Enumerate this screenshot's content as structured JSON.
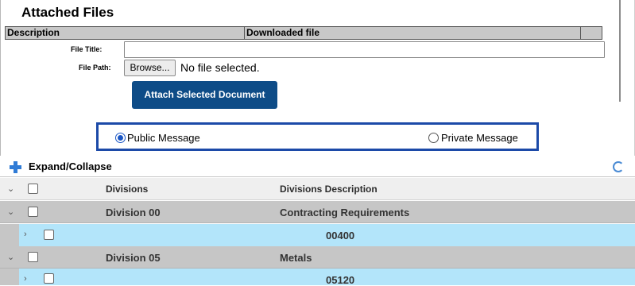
{
  "attached_files": {
    "title": "Attached Files",
    "columns": [
      "Description",
      "Downloaded file"
    ],
    "file_title_label": "File Title:",
    "file_title_value": "",
    "file_path_label": "File Path:",
    "browse_label": "Browse...",
    "no_file_text": "No file selected.",
    "attach_button": "Attach Selected Document"
  },
  "message_visibility": {
    "public_label": "Public Message",
    "private_label": "Private Message",
    "selected": "Public Message"
  },
  "grid": {
    "toolbar_label": "Expand/Collapse",
    "columns": [
      "Divisions",
      "Divisions Description"
    ],
    "rows": [
      {
        "division": "Division 00",
        "description": "Contracting Requirements",
        "detail": "00400"
      },
      {
        "division": "Division 05",
        "description": "Metals",
        "detail": "05120"
      }
    ]
  },
  "icons": [
    "plus-icon",
    "refresh-icon",
    "chevron-down-icon",
    "chevron-right-icon"
  ],
  "colors": {
    "accent_button": "#0e4c87",
    "focus_border": "#1c4aa8",
    "detail_row": "#b3e5fa",
    "group_row": "#c6c6c6"
  }
}
